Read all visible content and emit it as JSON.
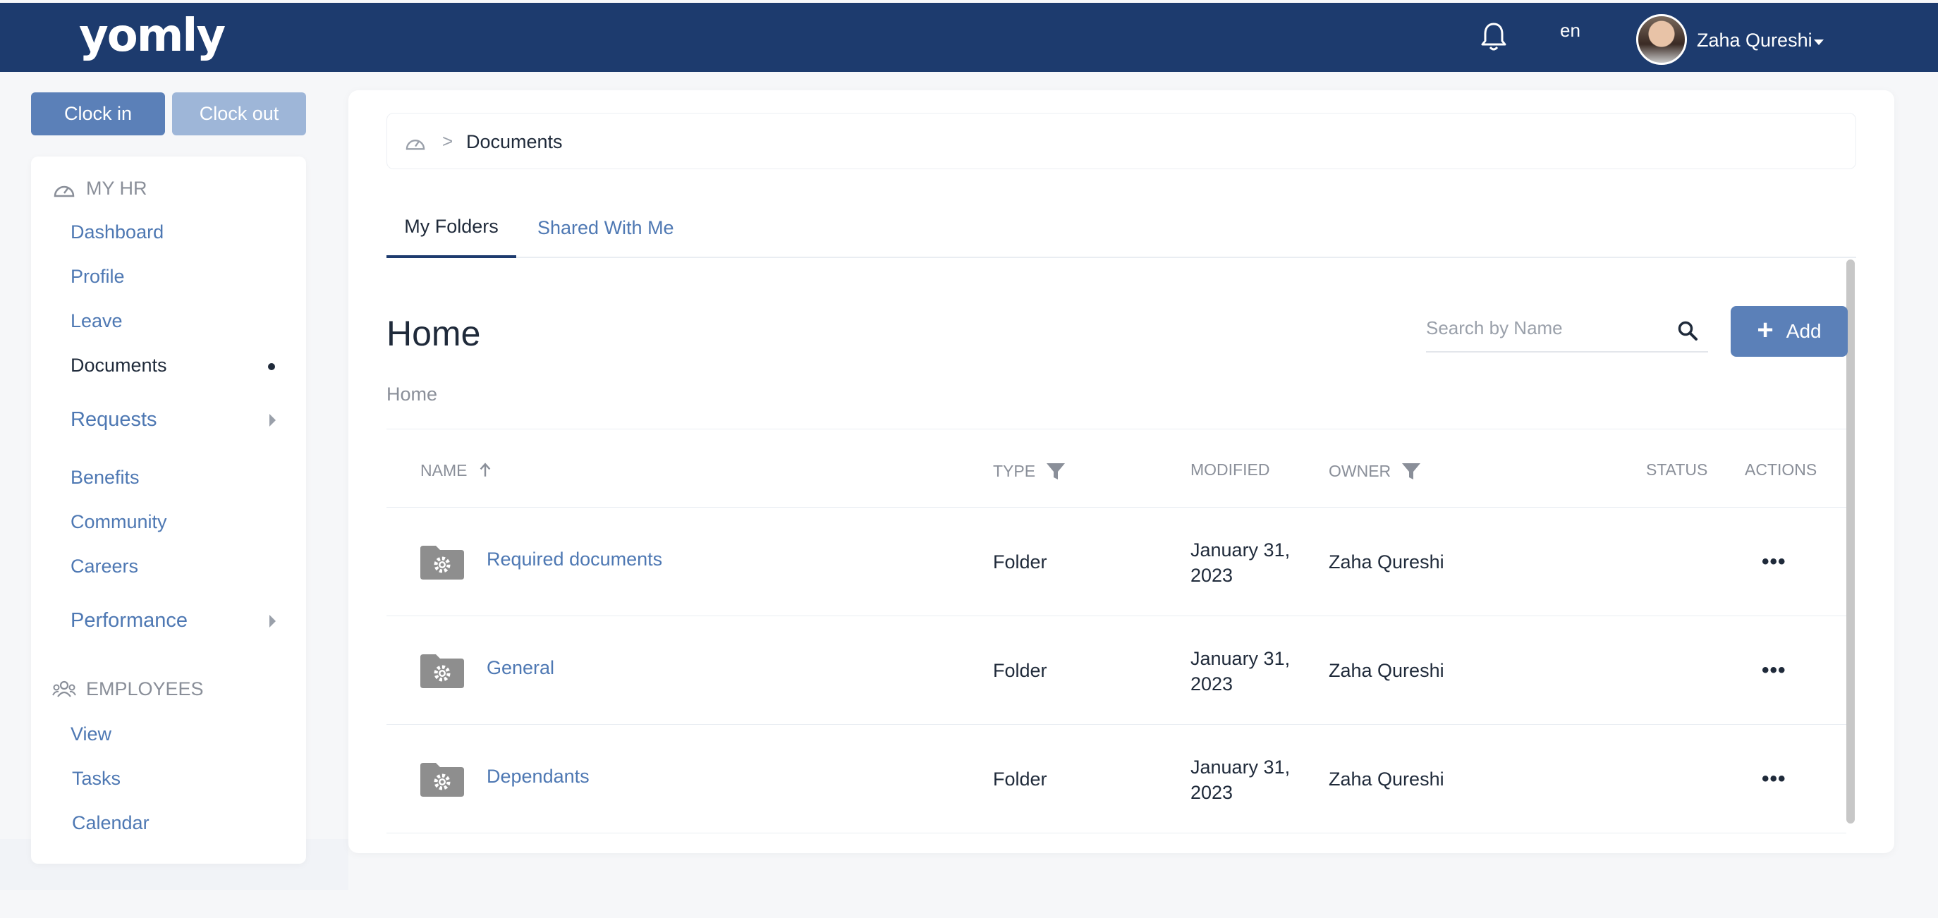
{
  "header": {
    "logo": "yomly",
    "language": "en",
    "user_name": "Zaha Qureshi",
    "icons": [
      "bell-icon",
      "chevron-down-icon",
      "avatar"
    ]
  },
  "clock": {
    "in_label": "Clock in",
    "out_label": "Clock out"
  },
  "sidebar": {
    "my_hr_label": "MY HR",
    "my_hr_items": [
      {
        "label": "Dashboard"
      },
      {
        "label": "Profile"
      },
      {
        "label": "Leave"
      },
      {
        "label": "Documents",
        "active": true
      },
      {
        "label": "Requests",
        "has_submenu": true
      },
      {
        "label": "Benefits"
      },
      {
        "label": "Community"
      },
      {
        "label": "Careers"
      },
      {
        "label": "Performance",
        "has_submenu": true
      }
    ],
    "employees_label": "EMPLOYEES",
    "employees_items": [
      {
        "label": "View"
      },
      {
        "label": "Tasks"
      },
      {
        "label": "Calendar"
      }
    ]
  },
  "breadcrumb": {
    "current": "Documents",
    "separator": ">"
  },
  "tabs": [
    {
      "label": "My Folders",
      "active": true
    },
    {
      "label": "Shared With Me",
      "active": false
    }
  ],
  "main": {
    "title": "Home",
    "folder_path": "Home",
    "search_placeholder": "Search by Name",
    "add_label": "Add"
  },
  "table": {
    "columns": {
      "name": "NAME",
      "type": "TYPE",
      "modified": "MODIFIED",
      "owner": "OWNER",
      "status": "STATUS",
      "actions": "ACTIONS"
    },
    "rows": [
      {
        "name": "Required documents",
        "type": "Folder",
        "modified_line1": "January 31,",
        "modified_line2": "2023",
        "owner": "Zaha Qureshi",
        "status": "",
        "actions": "•••"
      },
      {
        "name": "General",
        "type": "Folder",
        "modified_line1": "January 31,",
        "modified_line2": "2023",
        "owner": "Zaha Qureshi",
        "status": "",
        "actions": "•••"
      },
      {
        "name": "Dependants",
        "type": "Folder",
        "modified_line1": "January 31,",
        "modified_line2": "2023",
        "owner": "Zaha Qureshi",
        "status": "",
        "actions": "•••"
      }
    ]
  },
  "colors": {
    "topbar": "#1d3b6e",
    "accent": "#5b80b8",
    "link": "#4e78b3"
  }
}
